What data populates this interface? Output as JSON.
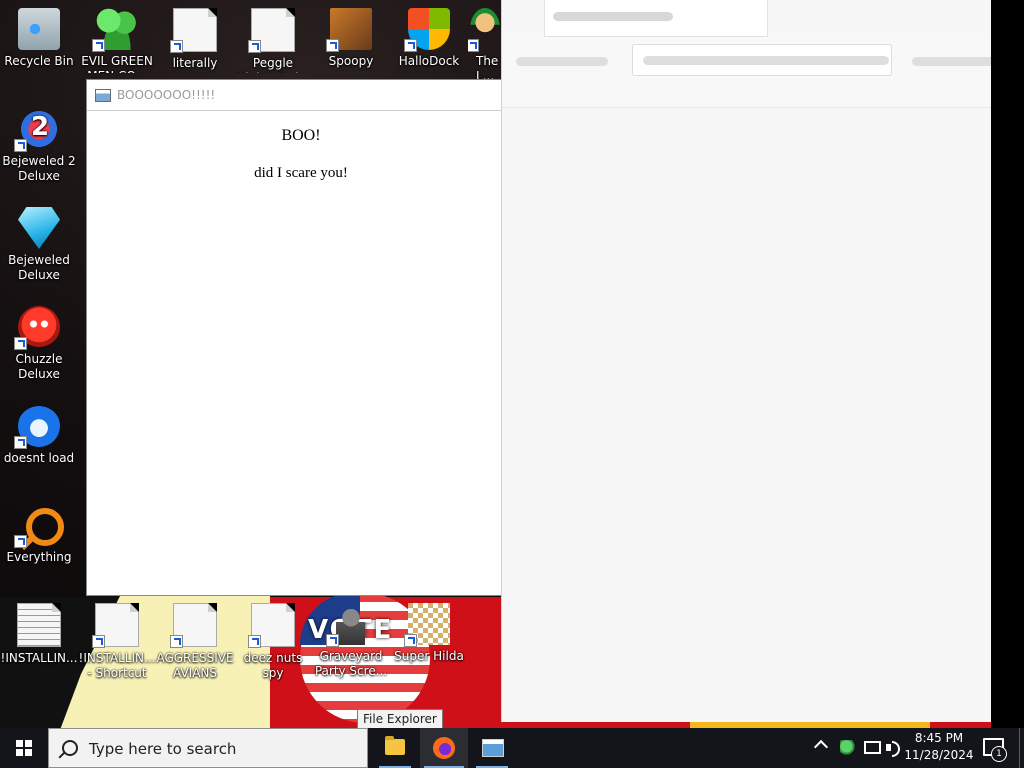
{
  "desktop": {
    "icons": [
      {
        "label": "Recycle Bin",
        "icon": "recycle-bin-icon"
      },
      {
        "label": "EVIL GREEN MEN CO...",
        "icon": "green-men-icon"
      },
      {
        "label": "literally",
        "icon": "document-icon"
      },
      {
        "label": "Peggle Nights Del...",
        "icon": "document-icon"
      },
      {
        "label": "Spoopy",
        "icon": "spoopy-icon"
      },
      {
        "label": "HalloDock",
        "icon": "windows-logo-icon"
      },
      {
        "label": "The L...",
        "icon": "luigi-icon"
      },
      {
        "label": "Bejeweled 2 Deluxe",
        "icon": "bejeweled-2-icon"
      },
      {
        "label": "Bejeweled Deluxe",
        "icon": "diamond-icon"
      },
      {
        "label": "Chuzzle Deluxe",
        "icon": "chuzzle-icon"
      },
      {
        "label": "doesnt load",
        "icon": "thunderbird-icon"
      },
      {
        "label": "Everything",
        "icon": "everything-search-icon"
      },
      {
        "label": "!INSTALLIN...",
        "icon": "text-file-icon"
      },
      {
        "label": "!INSTALLIN... - Shortcut",
        "icon": "document-icon"
      },
      {
        "label": "AGGRESSIVE AVIANS",
        "icon": "document-icon"
      },
      {
        "label": "deez nuts spy",
        "icon": "document-icon"
      },
      {
        "label": "Graveyard Party Scre...",
        "icon": "graveyard-icon"
      },
      {
        "label": "Super Hilda",
        "icon": "super-hilda-icon"
      }
    ],
    "badge_text": "VOTE"
  },
  "boo_window": {
    "title": "BOOOOOOO!!!!!",
    "heading": "BOO!",
    "message": "did I scare you!"
  },
  "tooltip": "File Explorer",
  "taskbar": {
    "search_placeholder": "Type here to search",
    "apps": [
      {
        "name": "File Explorer",
        "icon": "folder-icon"
      },
      {
        "name": "Firefox",
        "icon": "firefox-icon"
      },
      {
        "name": "BOOOOOOO!!!!!",
        "icon": "window-app-icon"
      }
    ],
    "time": "8:45 PM",
    "date": "11/28/2024",
    "notification_count": "1"
  }
}
